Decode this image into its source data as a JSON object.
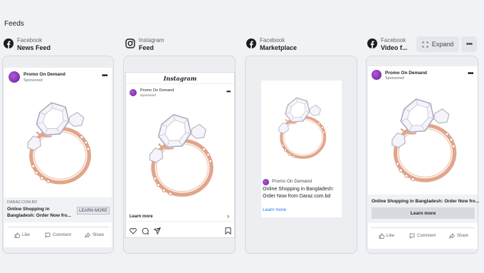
{
  "section_title": "Feeds",
  "toolbar": {
    "expand_label": "Expand",
    "more_label": "•••"
  },
  "columns": [
    {
      "platform": "Facebook",
      "placement": "News Feed",
      "icon": "facebook-icon"
    },
    {
      "platform": "Instagram",
      "placement": "Feed",
      "icon": "instagram-icon"
    },
    {
      "platform": "Facebook",
      "placement": "Marketplace",
      "icon": "facebook-icon"
    },
    {
      "platform": "Facebook",
      "placement": "Video f...",
      "icon": "facebook-icon"
    }
  ],
  "ad": {
    "page_name": "Promo On Demand",
    "sponsored": "Sponsored",
    "domain_upper": "DARAZ.COM.BD",
    "headline_short": "Online Shopping in Bangladesh: Order Now fro...",
    "headline_full": "Online Shopping in Bangladesh: Order Now from Daraz.com.bd",
    "headline_video": "Online Shopping in Bangladesh: Order Now fro...",
    "cta": "LEARN MORE",
    "cta_ig": "Learn more",
    "cta_marketplace": "Learn more",
    "cta_video": "Learn more",
    "more": "•••",
    "instagram_logo": "Instagram",
    "actions": {
      "like": "Like",
      "comment": "Comment",
      "share": "Share"
    }
  },
  "colors": {
    "accent": "#1877f2",
    "rose_gold": "#e2a58a",
    "stone": "#f4f4fa"
  }
}
